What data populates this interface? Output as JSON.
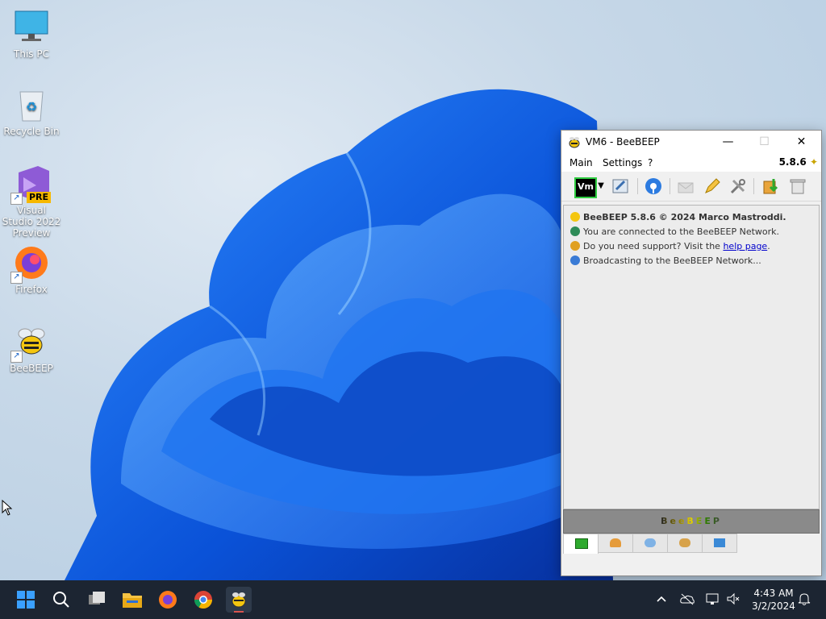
{
  "desktop": {
    "icons": [
      {
        "label": "This PC"
      },
      {
        "label": "Recycle Bin"
      },
      {
        "label": "Visual Studio 2022 Preview",
        "badge": "PRE"
      },
      {
        "label": "Firefox"
      },
      {
        "label": "BeeBEEP"
      }
    ]
  },
  "window": {
    "title": "VM6 - BeeBEEP",
    "minimize": "—",
    "maximize": "☐",
    "close": "✕",
    "menu": [
      "Main",
      "Settings",
      "?"
    ],
    "version": "5.8.6",
    "status_button": "Vm",
    "messages": [
      {
        "text": "BeeBEEP 5.8.6 © 2024 Marco Mastroddi.",
        "color": "#6b8e23"
      },
      {
        "text": "You are connected to the BeeBEEP Network.",
        "color": "#2e8b57"
      },
      {
        "text_before": "Do you need support? Visit the ",
        "link": "help page",
        "text_after": ".",
        "color": "#e0a020"
      },
      {
        "text": "Broadcasting to the BeeBEEP Network...",
        "color": "#3a7bd5"
      }
    ],
    "banner": "BeeBEEP",
    "tab_icons": [
      "chat-icon",
      "users-icon",
      "messages-icon",
      "groups-icon",
      "share-icon"
    ]
  },
  "taskbar": {
    "clock_time": "4:43 AM",
    "clock_date": "3/2/2024",
    "apps": [
      "start-icon",
      "search-icon",
      "task-view-icon",
      "file-explorer-icon",
      "firefox-icon",
      "chrome-icon",
      "beebeep-icon"
    ],
    "colors": {
      "bg": "#1c2532",
      "accent": "#0a84ff"
    }
  }
}
